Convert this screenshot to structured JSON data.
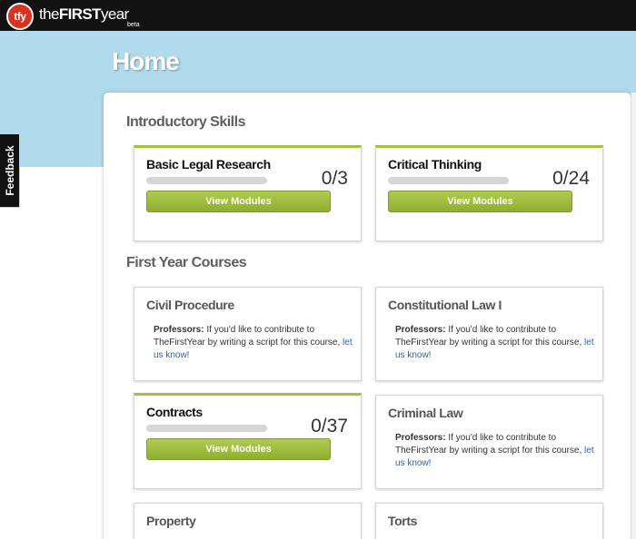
{
  "header": {
    "logo_badge": "tfy",
    "logo_text_pre": "the",
    "logo_text_bold": "FIRST",
    "logo_text_post": "year",
    "beta": "beta"
  },
  "page": {
    "title": "Home"
  },
  "feedback": {
    "label": "Feedback"
  },
  "sections": {
    "intro": {
      "title": "Introductory Skills",
      "cards": [
        {
          "title": "Basic Legal Research",
          "progress_text": "0/3",
          "progress_fraction": 0,
          "button": "View Modules"
        },
        {
          "title": "Critical Thinking",
          "progress_text": "0/24",
          "progress_fraction": 0,
          "button": "View Modules"
        }
      ]
    },
    "courses": {
      "title": "First Year Courses",
      "cards": [
        {
          "title": "Civil Procedure"
        },
        {
          "title": "Constitutional Law I"
        },
        {
          "title": "Contracts",
          "progress_text": "0/37",
          "progress_fraction": 0,
          "button": "View Modules"
        },
        {
          "title": "Criminal Law"
        },
        {
          "title": "Property"
        },
        {
          "title": "Torts"
        }
      ]
    }
  },
  "note": {
    "label": "Professors:",
    "body": " If you'd like to contribute to TheFirstYear by writing a script for this course, ",
    "link": "let us know!"
  },
  "colors": {
    "accent": "#a3c13f",
    "hero": "#b1dbec",
    "topbar": "#121212",
    "logo": "#d9321f",
    "link": "#2b63b0"
  }
}
